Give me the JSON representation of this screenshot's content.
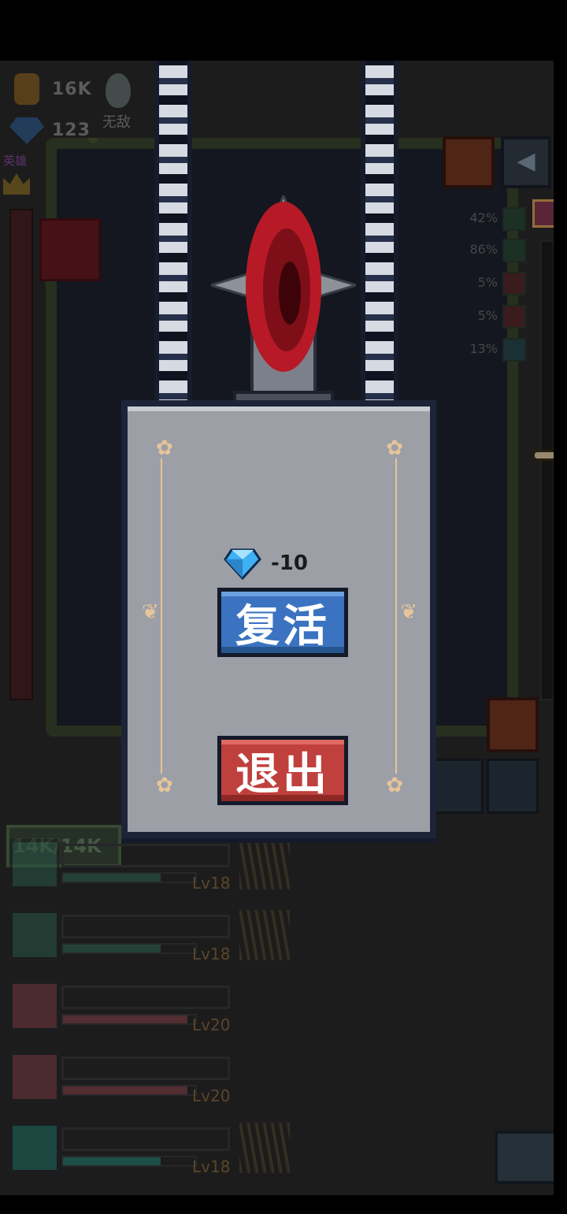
{
  "resources": {
    "gold_value": "16K",
    "gem_value": "123",
    "invincible_label": "无敌",
    "hero_label": "英雄"
  },
  "side_panel": {
    "percentages": [
      "42%",
      "86%",
      "5%",
      "5%",
      "13%"
    ]
  },
  "hp_box": {
    "value": "14K/14K"
  },
  "revive_dialog": {
    "cost_value": "-10",
    "revive_label": "复活",
    "exit_label": "退出"
  },
  "equipment": [
    {
      "level": "Lv18",
      "progress": 0.74,
      "color": "#3f7d66"
    },
    {
      "level": "Lv18",
      "progress": 0.74,
      "color": "#3f7d66"
    },
    {
      "level": "Lv20",
      "progress": 0.94,
      "color": "#a3525a"
    },
    {
      "level": "Lv20",
      "progress": 0.94,
      "color": "#a3525a"
    },
    {
      "level": "Lv18",
      "progress": 0.74,
      "color": "#2d9b87"
    }
  ],
  "colors": {
    "revive_button": "#3b73c0",
    "exit_button": "#c0403d",
    "dialog_panel": "#9c9fa6",
    "frame_gold": "#e7c49a"
  }
}
